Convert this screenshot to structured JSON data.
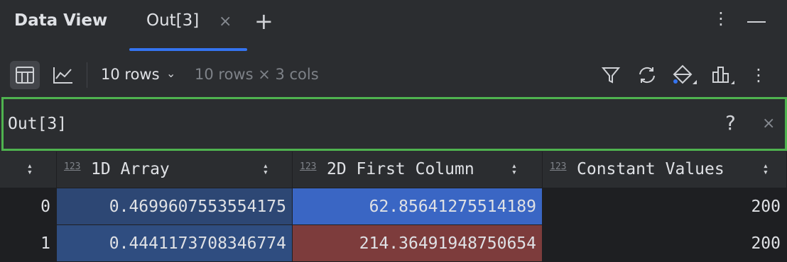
{
  "window": {
    "title": "Data View",
    "more_icon": "more-vertical-icon",
    "minimize_icon": "minimize-icon"
  },
  "tabs": [
    {
      "label": "Out[3]",
      "close": "×",
      "active": true
    }
  ],
  "add_tab_glyph": "+",
  "toolbar": {
    "rows_selected": "10 rows",
    "dimensions": "10 rows × 3 cols",
    "icons": [
      "table-view-icon",
      "chart-view-icon",
      "filter-icon",
      "refresh-icon",
      "color-fill-icon",
      "column-chart-icon",
      "more-vertical-icon"
    ]
  },
  "filter": {
    "value": "Out[3]",
    "help": "?",
    "close": "×"
  },
  "table": {
    "columns": [
      {
        "type": "123",
        "label": "1D Array"
      },
      {
        "type": "123",
        "label": "2D First Column"
      },
      {
        "type": "123",
        "label": "Constant Values"
      }
    ],
    "rows": [
      {
        "index": "0",
        "cells": [
          "0.4699607553554175",
          "62.85641275514189",
          "200"
        ]
      },
      {
        "index": "1",
        "cells": [
          "0.4441173708346774",
          "214.36491948750654",
          "200"
        ]
      }
    ]
  },
  "colors": {
    "accent": "#3574f0",
    "filter_border": "#4fb34f",
    "cell_dark_blue": "#2d4774",
    "cell_blue": "#3a66c4",
    "cell_red": "#7d3c3c"
  }
}
